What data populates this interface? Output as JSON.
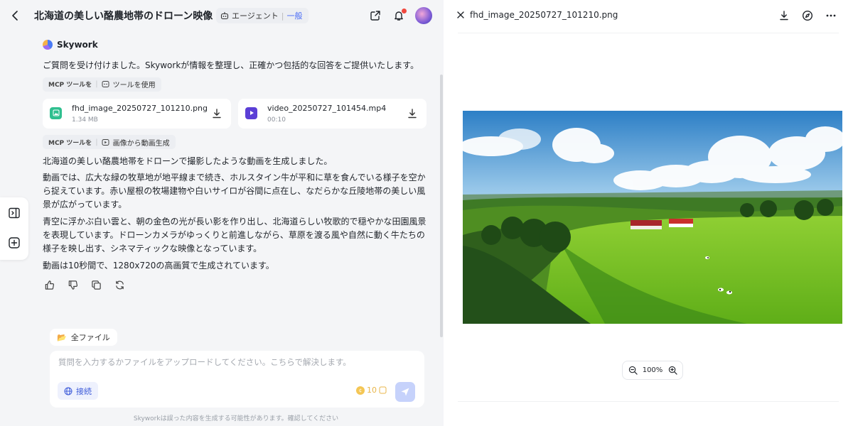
{
  "header": {
    "title": "北海道の美しい酪農地帯のドローン映像",
    "agent_label": "エージェント",
    "agent_mode": "一般"
  },
  "message": {
    "brand": "Skywork",
    "intro": "ご質問を受け付けました。Skyworkが情報を整理し、正確かつ包括的な回答をご提供いたします。",
    "tool_chip_1": {
      "mcp": "MCP ツールを",
      "label": "ツールを使用"
    },
    "files": [
      {
        "name": "fhd_image_20250727_101210.png",
        "meta": "1.34 MB",
        "kind": "image"
      },
      {
        "name": "video_20250727_101454.mp4",
        "meta": "00:10",
        "kind": "video"
      }
    ],
    "tool_chip_2": {
      "mcp": "MCP ツールを",
      "label": "画像から動画生成"
    },
    "paragraphs": [
      "北海道の美しい酪農地帯をドローンで撮影したような動画を生成しました。",
      "動画では、広大な緑の牧草地が地平線まで続き、ホルスタイン牛が平和に草を食んでいる様子を空から捉えています。赤い屋根の牧場建物や白いサイロが谷間に点在し、なだらかな丘陵地帯の美しい風景が広がっています。",
      "青空に浮かぶ白い雲と、朝の金色の光が長い影を作り出し、北海道らしい牧歌的で穏やかな田園風景を表現しています。ドローンカメラがゆっくりと前進しながら、草原を渡る風や自然に動く牛たちの様子を映し出す、シネマティックな映像となっています。",
      "動画は10秒間で、1280x720の高画質で生成されています。"
    ]
  },
  "composer": {
    "all_files": "全ファイル",
    "placeholder": "質問を入力するかファイルをアップロードしてください。こちらで解決します。",
    "connect": "接続",
    "credits": "10"
  },
  "disclaimer": "Skyworkは誤った内容を生成する可能性があります。確認してください",
  "preview": {
    "filename": "fhd_image_20250727_101210.png",
    "zoom": "100%"
  },
  "colors": {
    "accent": "#4a6cf7",
    "image_file_icon": "#2fbf8f",
    "video_file_icon": "#5b3fd6",
    "notification": "#f0483e"
  }
}
